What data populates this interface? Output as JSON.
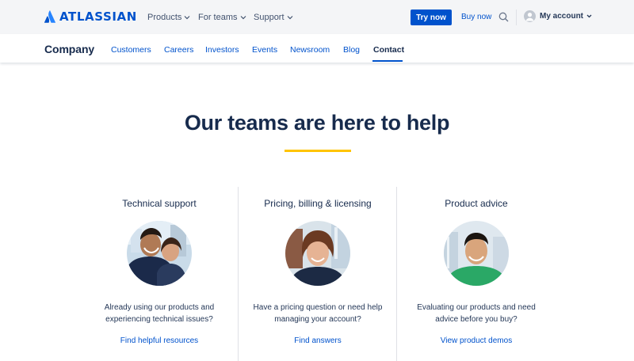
{
  "brand": {
    "name": "ATLASSIAN",
    "color": "#0052cc"
  },
  "topnav": {
    "products": "Products",
    "teams": "For teams",
    "support": "Support",
    "try_now": "Try now",
    "buy_now": "Buy now",
    "account": "My account",
    "search_icon": "search-icon"
  },
  "subnav": {
    "title": "Company",
    "items": [
      "Customers",
      "Careers",
      "Investors",
      "Events",
      "Newsroom",
      "Blog",
      "Contact"
    ],
    "active": "Contact"
  },
  "hero": {
    "title": "Our teams are here to help",
    "accent": "#ffc400"
  },
  "cards": [
    {
      "title": "Technical support",
      "description_line1": "Already using our products and",
      "description_line2": "experiencing technical issues?",
      "link": "Find helpful resources"
    },
    {
      "title": "Pricing, billing & licensing",
      "description_line1": "Have a pricing question or need help",
      "description_line2": "managing your account?",
      "link": "Find answers"
    },
    {
      "title": "Product advice",
      "description_line1": "Evaluating our products and need",
      "description_line2": "advice before you buy?",
      "link": "View product demos"
    }
  ]
}
